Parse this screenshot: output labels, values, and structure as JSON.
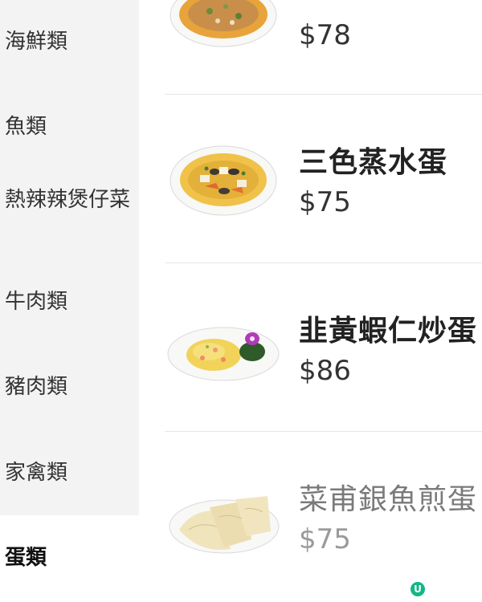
{
  "sidebar": {
    "categories": [
      {
        "label": "海鮮類"
      },
      {
        "label": "魚類"
      },
      {
        "label": "熱辣辣煲仔菜"
      },
      {
        "label": "牛肉類"
      },
      {
        "label": "豬肉類"
      },
      {
        "label": "家禽類"
      },
      {
        "label": "蛋類",
        "active": true
      }
    ]
  },
  "menu": {
    "items": [
      {
        "name": "",
        "price": "$78"
      },
      {
        "name": "三色蒸水蛋",
        "price": "$75"
      },
      {
        "name": "韭黃蝦仁炒蛋",
        "price": "$86"
      },
      {
        "name": "菜甫銀魚煎蛋",
        "price": "$75",
        "dimmed": true
      }
    ]
  },
  "badge": {
    "label": "U",
    "color": "#12b886"
  }
}
